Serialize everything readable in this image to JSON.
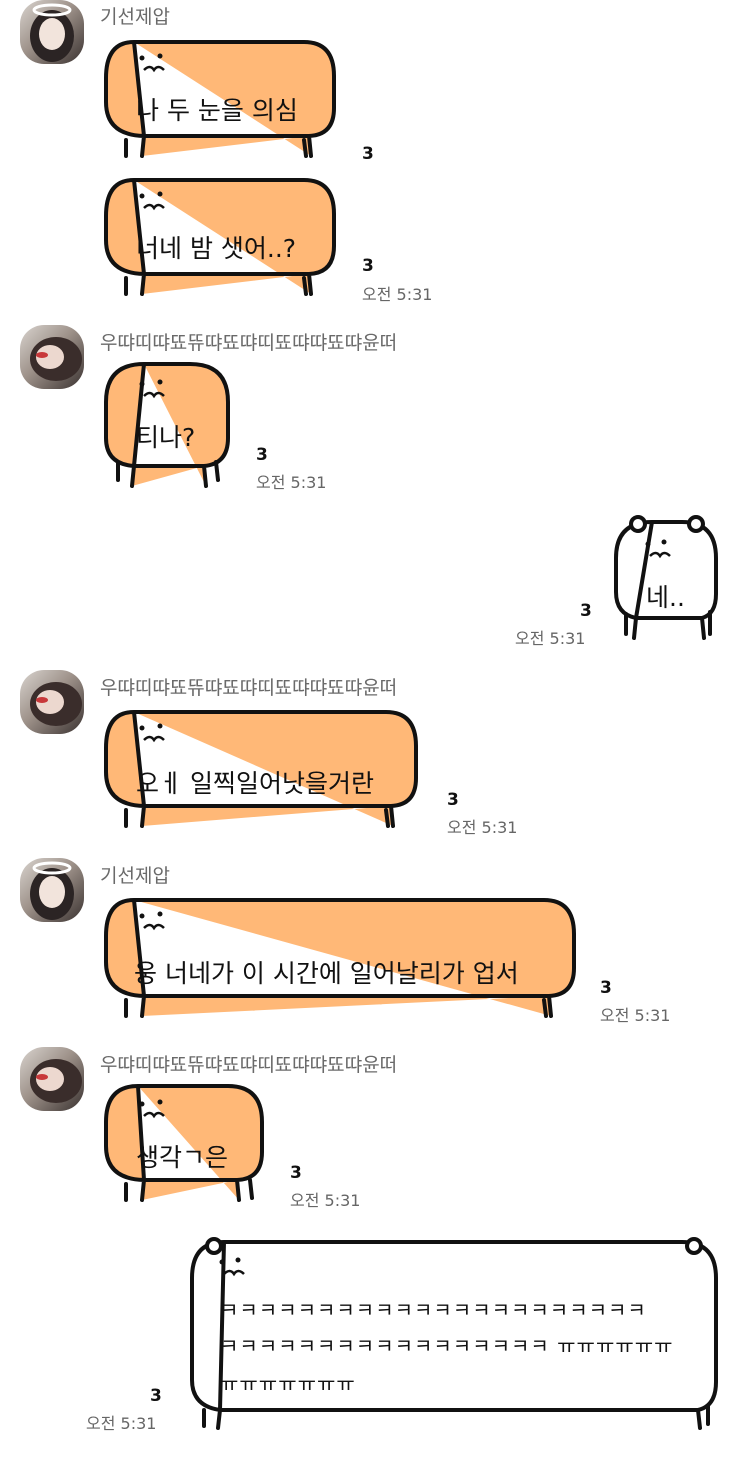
{
  "messages": [
    {
      "sender": "기선제압",
      "bubbles": [
        {
          "text": "나 두 눈을 의심",
          "unread": "3"
        },
        {
          "text": "너네 밤 샛어..?",
          "unread": "3",
          "time": "오전 5:31"
        }
      ]
    },
    {
      "sender": "우땨띠땨뚀뜌땨뚀땨띠뚀땨땨뚀땨윤떠",
      "bubbles": [
        {
          "text": "티나?",
          "unread": "3",
          "time": "오전 5:31"
        }
      ]
    },
    {
      "sender": "me",
      "bubbles": [
        {
          "text": "네..",
          "unread": "3",
          "time": "오전 5:31"
        }
      ]
    },
    {
      "sender": "우땨띠땨뚀뜌땨뚀땨띠뚀땨땨뚀땨윤떠",
      "bubbles": [
        {
          "text": "오ㅔ 일찍일어낫을거란",
          "unread": "3",
          "time": "오전 5:31"
        }
      ]
    },
    {
      "sender": "기선제압",
      "bubbles": [
        {
          "text": "웅 너네가 이 시간에 일어날리가 업서",
          "unread": "3",
          "time": "오전 5:31"
        }
      ]
    },
    {
      "sender": "우땨띠땨뚀뜌땨뚀땨띠뚀땨땨뚀땨윤떠",
      "bubbles": [
        {
          "text": "생각ㄱ은",
          "unread": "3",
          "time": "오전 5:31"
        }
      ]
    },
    {
      "sender": "me",
      "bubbles": [
        {
          "lines": [
            "ㅋㅋㅋㅋㅋㅋㅋㅋㅋㅋㅋㅋㅋㅋㅋㅋㅋㅋㅋㅋㅋㅋ",
            "ㅋㅋㅋㅋㅋㅋㅋㅋㅋㅋㅋㅋㅋㅋㅋㅋㅋ ㅠㅠㅠㅠㅠㅠ",
            "ㅠㅠㅠㅠㅠㅠㅠ"
          ],
          "unread": "3",
          "time": "오전 5:31"
        }
      ]
    }
  ],
  "colors": {
    "bubble_in": "#ffb877",
    "bubble_out": "#ffffff",
    "outline": "#111111"
  }
}
